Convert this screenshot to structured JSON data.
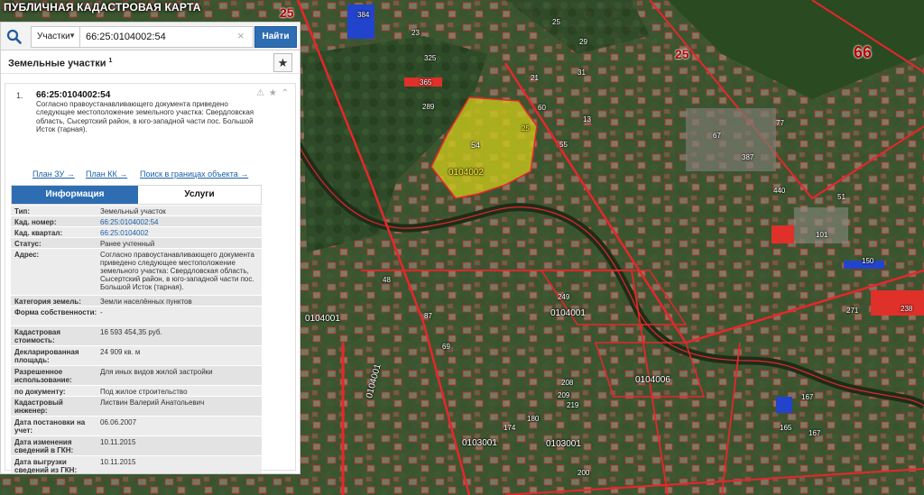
{
  "app": {
    "title": "ПУБЛИЧНАЯ КАДАСТРОВАЯ КАРТА"
  },
  "search": {
    "type_label": "Участки",
    "value": "66:25:0104002:54",
    "find_label": "Найти",
    "clear_label": "×"
  },
  "results": {
    "title": "Земельные участки",
    "count": "1",
    "fav_label": "★"
  },
  "item": {
    "index": "1.",
    "cadastral_number": "66:25:0104002:54",
    "icons": "⚠ ★ ⌃",
    "description": "Согласно правоустанавливающего документа приведено следующее местоположение земельного участка: Свердловская область, Сысертский район, в юго-западной части пос. Большой Исток (тарная).",
    "links": [
      "План ЗУ →",
      "План КК →",
      "Поиск в границах объекта →"
    ],
    "tabs": {
      "info": "Информация",
      "services": "Услуги"
    }
  },
  "attributes": [
    {
      "label": "Тип:",
      "value": "Земельный участок"
    },
    {
      "label": "Кад. номер:",
      "value": "66:25:0104002:54",
      "link": true
    },
    {
      "label": "Кад. квартал:",
      "value": "66:25:0104002",
      "link": true
    },
    {
      "label": "Статус:",
      "value": "Ранее учтенный"
    },
    {
      "label": "Адрес:",
      "value": "Согласно правоустанавливающего документа приведено следующее местоположение земельного участка: Свердловская область, Сысертский район, в юго-западной части пос. Большой Исток (тарная)."
    },
    {
      "label": "Категория земель:",
      "value": "Земли населённых пунктов"
    },
    {
      "label": "Форма собственности:",
      "value": "-"
    },
    {
      "label": "Кадастровая стоимость:",
      "value": "16 593 454,35 руб."
    },
    {
      "label": "Декларированная площадь:",
      "value": "24 909 кв. м"
    },
    {
      "label": "Разрешенное использование:",
      "value": "Для иных видов жилой застройки"
    },
    {
      "label": "по документу:",
      "value": "Под жилое строительство"
    },
    {
      "label": "Кадастровый инженер:",
      "value": "Листвин Валерий Анатольевич"
    },
    {
      "label": "Дата постановки на учет:",
      "value": "06.06.2007"
    },
    {
      "label": "Дата изменения сведений в ГКН:",
      "value": "10.11.2015"
    },
    {
      "label": "Дата выгрузки сведений из ГКН:",
      "value": "10.11.2015"
    }
  ],
  "map": {
    "big_labels": [
      "25",
      "25",
      "66"
    ],
    "parcel_labels": [
      "54",
      "0104002",
      "25"
    ],
    "quarter_labels": [
      "0104001",
      "0104001",
      "0104006",
      "0103001",
      "0103001",
      "0104001"
    ],
    "small_labels": [
      "384",
      "23",
      "325",
      "365",
      "289",
      "21",
      "31",
      "60",
      "55",
      "29",
      "25",
      "13",
      "48",
      "387",
      "67",
      "77",
      "440",
      "51",
      "101",
      "150",
      "271",
      "238",
      "167",
      "165",
      "167",
      "219",
      "249",
      "208",
      "209",
      "180",
      "174",
      "200",
      "69",
      "87"
    ],
    "colors": {
      "boundary": "#e8262b",
      "highlight": "#c9c81a",
      "water": "#20331c",
      "blue_roof": "#2244cc",
      "red_roof": "#e0302a"
    }
  }
}
